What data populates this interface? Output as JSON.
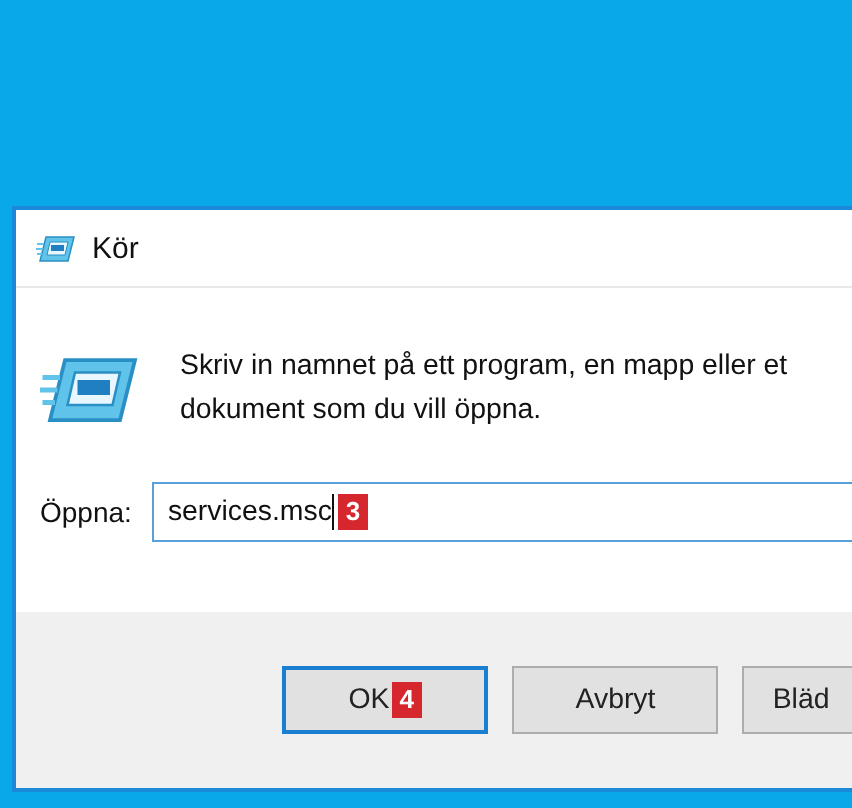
{
  "window": {
    "title": "Kör"
  },
  "prompt_lines": [
    "Skriv in namnet på ett program, en mapp eller et",
    "dokument som du vill öppna."
  ],
  "open_field": {
    "label": "Öppna:",
    "value": "services.msc",
    "badge": "3",
    "focused": true
  },
  "buttons": [
    {
      "label": "OK",
      "default": true,
      "badge": "4"
    },
    {
      "label": "Avbryt",
      "default": false
    },
    {
      "label": "Bläd",
      "default": false
    }
  ]
}
